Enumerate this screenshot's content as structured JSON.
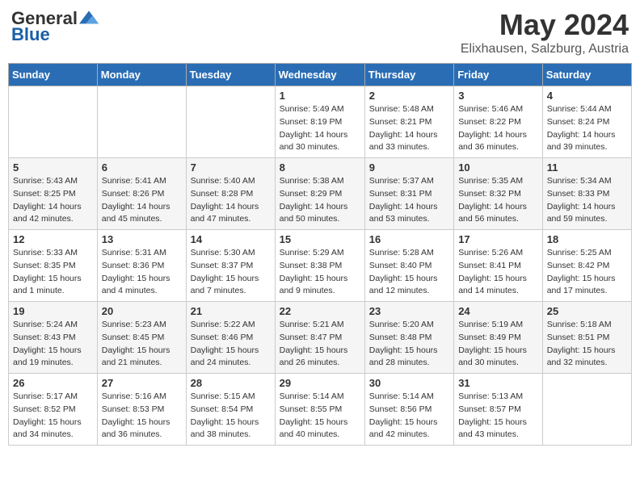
{
  "logo": {
    "general": "General",
    "blue": "Blue"
  },
  "title": {
    "month": "May 2024",
    "location": "Elixhausen, Salzburg, Austria"
  },
  "weekdays": [
    "Sunday",
    "Monday",
    "Tuesday",
    "Wednesday",
    "Thursday",
    "Friday",
    "Saturday"
  ],
  "weeks": [
    [
      {
        "day": "",
        "info": ""
      },
      {
        "day": "",
        "info": ""
      },
      {
        "day": "",
        "info": ""
      },
      {
        "day": "1",
        "info": "Sunrise: 5:49 AM\nSunset: 8:19 PM\nDaylight: 14 hours\nand 30 minutes."
      },
      {
        "day": "2",
        "info": "Sunrise: 5:48 AM\nSunset: 8:21 PM\nDaylight: 14 hours\nand 33 minutes."
      },
      {
        "day": "3",
        "info": "Sunrise: 5:46 AM\nSunset: 8:22 PM\nDaylight: 14 hours\nand 36 minutes."
      },
      {
        "day": "4",
        "info": "Sunrise: 5:44 AM\nSunset: 8:24 PM\nDaylight: 14 hours\nand 39 minutes."
      }
    ],
    [
      {
        "day": "5",
        "info": "Sunrise: 5:43 AM\nSunset: 8:25 PM\nDaylight: 14 hours\nand 42 minutes."
      },
      {
        "day": "6",
        "info": "Sunrise: 5:41 AM\nSunset: 8:26 PM\nDaylight: 14 hours\nand 45 minutes."
      },
      {
        "day": "7",
        "info": "Sunrise: 5:40 AM\nSunset: 8:28 PM\nDaylight: 14 hours\nand 47 minutes."
      },
      {
        "day": "8",
        "info": "Sunrise: 5:38 AM\nSunset: 8:29 PM\nDaylight: 14 hours\nand 50 minutes."
      },
      {
        "day": "9",
        "info": "Sunrise: 5:37 AM\nSunset: 8:31 PM\nDaylight: 14 hours\nand 53 minutes."
      },
      {
        "day": "10",
        "info": "Sunrise: 5:35 AM\nSunset: 8:32 PM\nDaylight: 14 hours\nand 56 minutes."
      },
      {
        "day": "11",
        "info": "Sunrise: 5:34 AM\nSunset: 8:33 PM\nDaylight: 14 hours\nand 59 minutes."
      }
    ],
    [
      {
        "day": "12",
        "info": "Sunrise: 5:33 AM\nSunset: 8:35 PM\nDaylight: 15 hours\nand 1 minute."
      },
      {
        "day": "13",
        "info": "Sunrise: 5:31 AM\nSunset: 8:36 PM\nDaylight: 15 hours\nand 4 minutes."
      },
      {
        "day": "14",
        "info": "Sunrise: 5:30 AM\nSunset: 8:37 PM\nDaylight: 15 hours\nand 7 minutes."
      },
      {
        "day": "15",
        "info": "Sunrise: 5:29 AM\nSunset: 8:38 PM\nDaylight: 15 hours\nand 9 minutes."
      },
      {
        "day": "16",
        "info": "Sunrise: 5:28 AM\nSunset: 8:40 PM\nDaylight: 15 hours\nand 12 minutes."
      },
      {
        "day": "17",
        "info": "Sunrise: 5:26 AM\nSunset: 8:41 PM\nDaylight: 15 hours\nand 14 minutes."
      },
      {
        "day": "18",
        "info": "Sunrise: 5:25 AM\nSunset: 8:42 PM\nDaylight: 15 hours\nand 17 minutes."
      }
    ],
    [
      {
        "day": "19",
        "info": "Sunrise: 5:24 AM\nSunset: 8:43 PM\nDaylight: 15 hours\nand 19 minutes."
      },
      {
        "day": "20",
        "info": "Sunrise: 5:23 AM\nSunset: 8:45 PM\nDaylight: 15 hours\nand 21 minutes."
      },
      {
        "day": "21",
        "info": "Sunrise: 5:22 AM\nSunset: 8:46 PM\nDaylight: 15 hours\nand 24 minutes."
      },
      {
        "day": "22",
        "info": "Sunrise: 5:21 AM\nSunset: 8:47 PM\nDaylight: 15 hours\nand 26 minutes."
      },
      {
        "day": "23",
        "info": "Sunrise: 5:20 AM\nSunset: 8:48 PM\nDaylight: 15 hours\nand 28 minutes."
      },
      {
        "day": "24",
        "info": "Sunrise: 5:19 AM\nSunset: 8:49 PM\nDaylight: 15 hours\nand 30 minutes."
      },
      {
        "day": "25",
        "info": "Sunrise: 5:18 AM\nSunset: 8:51 PM\nDaylight: 15 hours\nand 32 minutes."
      }
    ],
    [
      {
        "day": "26",
        "info": "Sunrise: 5:17 AM\nSunset: 8:52 PM\nDaylight: 15 hours\nand 34 minutes."
      },
      {
        "day": "27",
        "info": "Sunrise: 5:16 AM\nSunset: 8:53 PM\nDaylight: 15 hours\nand 36 minutes."
      },
      {
        "day": "28",
        "info": "Sunrise: 5:15 AM\nSunset: 8:54 PM\nDaylight: 15 hours\nand 38 minutes."
      },
      {
        "day": "29",
        "info": "Sunrise: 5:14 AM\nSunset: 8:55 PM\nDaylight: 15 hours\nand 40 minutes."
      },
      {
        "day": "30",
        "info": "Sunrise: 5:14 AM\nSunset: 8:56 PM\nDaylight: 15 hours\nand 42 minutes."
      },
      {
        "day": "31",
        "info": "Sunrise: 5:13 AM\nSunset: 8:57 PM\nDaylight: 15 hours\nand 43 minutes."
      },
      {
        "day": "",
        "info": ""
      }
    ]
  ]
}
